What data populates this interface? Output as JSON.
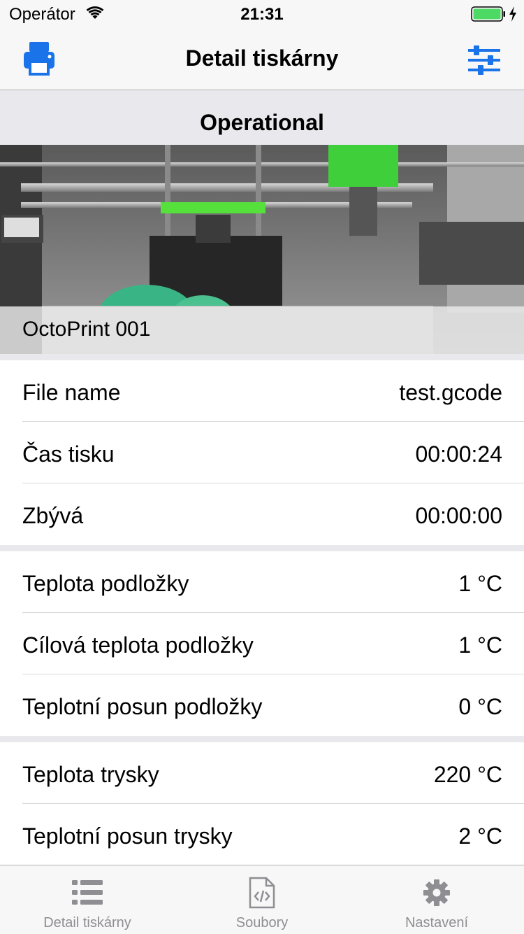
{
  "status_bar": {
    "carrier": "Operátor",
    "time": "21:31",
    "icons": [
      "wifi-icon",
      "battery-icon",
      "charging-bolt-icon"
    ]
  },
  "nav": {
    "title": "Detail tiskárny",
    "left_icon": "printer-icon",
    "right_icon": "sliders-icon",
    "accent_color": "#1a73e8"
  },
  "printer": {
    "state": "Operational",
    "name": "OctoPrint 001"
  },
  "job": {
    "rows": [
      {
        "label": "File name",
        "value": "test.gcode"
      },
      {
        "label": "Čas tisku",
        "value": "00:00:24"
      },
      {
        "label": "Zbývá",
        "value": "00:00:00"
      }
    ]
  },
  "bed": {
    "rows": [
      {
        "label": "Teplota podložky",
        "value": "1 °C"
      },
      {
        "label": "Cílová teplota podložky",
        "value": "1 °C"
      },
      {
        "label": "Teplotní posun podložky",
        "value": "0 °C"
      }
    ]
  },
  "nozzle": {
    "rows": [
      {
        "label": "Teplota trysky",
        "value": "220 °C"
      },
      {
        "label": "Teplotní posun trysky",
        "value": "2 °C"
      }
    ]
  },
  "tabs": [
    {
      "label": "Detail tiskárny",
      "icon": "list-icon"
    },
    {
      "label": "Soubory",
      "icon": "code-file-icon"
    },
    {
      "label": "Nastavení",
      "icon": "gear-icon"
    }
  ],
  "colors": {
    "accent": "#1a73e8",
    "group_background": "#e8e8ed",
    "tab_inactive": "#8e8e93",
    "battery": "#4cd964"
  }
}
